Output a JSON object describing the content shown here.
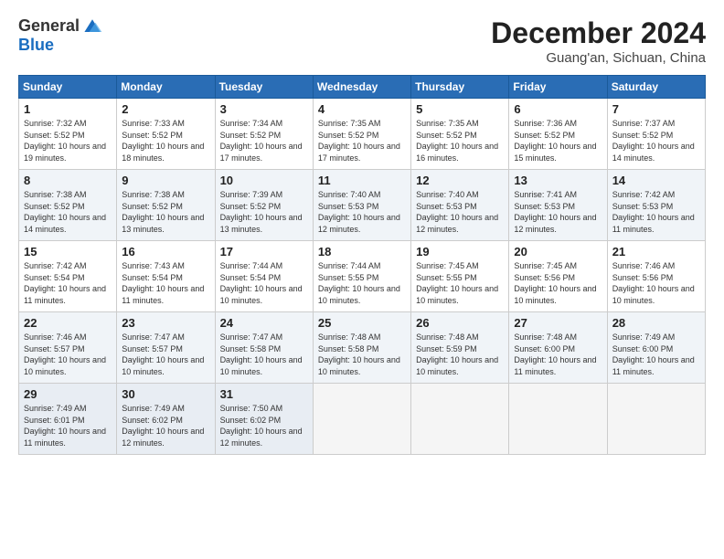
{
  "logo": {
    "general": "General",
    "blue": "Blue"
  },
  "title": "December 2024",
  "subtitle": "Guang'an, Sichuan, China",
  "days_of_week": [
    "Sunday",
    "Monday",
    "Tuesday",
    "Wednesday",
    "Thursday",
    "Friday",
    "Saturday"
  ],
  "weeks": [
    [
      {
        "day": "1",
        "sunrise": "Sunrise: 7:32 AM",
        "sunset": "Sunset: 5:52 PM",
        "daylight": "Daylight: 10 hours and 19 minutes."
      },
      {
        "day": "2",
        "sunrise": "Sunrise: 7:33 AM",
        "sunset": "Sunset: 5:52 PM",
        "daylight": "Daylight: 10 hours and 18 minutes."
      },
      {
        "day": "3",
        "sunrise": "Sunrise: 7:34 AM",
        "sunset": "Sunset: 5:52 PM",
        "daylight": "Daylight: 10 hours and 17 minutes."
      },
      {
        "day": "4",
        "sunrise": "Sunrise: 7:35 AM",
        "sunset": "Sunset: 5:52 PM",
        "daylight": "Daylight: 10 hours and 17 minutes."
      },
      {
        "day": "5",
        "sunrise": "Sunrise: 7:35 AM",
        "sunset": "Sunset: 5:52 PM",
        "daylight": "Daylight: 10 hours and 16 minutes."
      },
      {
        "day": "6",
        "sunrise": "Sunrise: 7:36 AM",
        "sunset": "Sunset: 5:52 PM",
        "daylight": "Daylight: 10 hours and 15 minutes."
      },
      {
        "day": "7",
        "sunrise": "Sunrise: 7:37 AM",
        "sunset": "Sunset: 5:52 PM",
        "daylight": "Daylight: 10 hours and 14 minutes."
      }
    ],
    [
      {
        "day": "8",
        "sunrise": "Sunrise: 7:38 AM",
        "sunset": "Sunset: 5:52 PM",
        "daylight": "Daylight: 10 hours and 14 minutes."
      },
      {
        "day": "9",
        "sunrise": "Sunrise: 7:38 AM",
        "sunset": "Sunset: 5:52 PM",
        "daylight": "Daylight: 10 hours and 13 minutes."
      },
      {
        "day": "10",
        "sunrise": "Sunrise: 7:39 AM",
        "sunset": "Sunset: 5:52 PM",
        "daylight": "Daylight: 10 hours and 13 minutes."
      },
      {
        "day": "11",
        "sunrise": "Sunrise: 7:40 AM",
        "sunset": "Sunset: 5:53 PM",
        "daylight": "Daylight: 10 hours and 12 minutes."
      },
      {
        "day": "12",
        "sunrise": "Sunrise: 7:40 AM",
        "sunset": "Sunset: 5:53 PM",
        "daylight": "Daylight: 10 hours and 12 minutes."
      },
      {
        "day": "13",
        "sunrise": "Sunrise: 7:41 AM",
        "sunset": "Sunset: 5:53 PM",
        "daylight": "Daylight: 10 hours and 12 minutes."
      },
      {
        "day": "14",
        "sunrise": "Sunrise: 7:42 AM",
        "sunset": "Sunset: 5:53 PM",
        "daylight": "Daylight: 10 hours and 11 minutes."
      }
    ],
    [
      {
        "day": "15",
        "sunrise": "Sunrise: 7:42 AM",
        "sunset": "Sunset: 5:54 PM",
        "daylight": "Daylight: 10 hours and 11 minutes."
      },
      {
        "day": "16",
        "sunrise": "Sunrise: 7:43 AM",
        "sunset": "Sunset: 5:54 PM",
        "daylight": "Daylight: 10 hours and 11 minutes."
      },
      {
        "day": "17",
        "sunrise": "Sunrise: 7:44 AM",
        "sunset": "Sunset: 5:54 PM",
        "daylight": "Daylight: 10 hours and 10 minutes."
      },
      {
        "day": "18",
        "sunrise": "Sunrise: 7:44 AM",
        "sunset": "Sunset: 5:55 PM",
        "daylight": "Daylight: 10 hours and 10 minutes."
      },
      {
        "day": "19",
        "sunrise": "Sunrise: 7:45 AM",
        "sunset": "Sunset: 5:55 PM",
        "daylight": "Daylight: 10 hours and 10 minutes."
      },
      {
        "day": "20",
        "sunrise": "Sunrise: 7:45 AM",
        "sunset": "Sunset: 5:56 PM",
        "daylight": "Daylight: 10 hours and 10 minutes."
      },
      {
        "day": "21",
        "sunrise": "Sunrise: 7:46 AM",
        "sunset": "Sunset: 5:56 PM",
        "daylight": "Daylight: 10 hours and 10 minutes."
      }
    ],
    [
      {
        "day": "22",
        "sunrise": "Sunrise: 7:46 AM",
        "sunset": "Sunset: 5:57 PM",
        "daylight": "Daylight: 10 hours and 10 minutes."
      },
      {
        "day": "23",
        "sunrise": "Sunrise: 7:47 AM",
        "sunset": "Sunset: 5:57 PM",
        "daylight": "Daylight: 10 hours and 10 minutes."
      },
      {
        "day": "24",
        "sunrise": "Sunrise: 7:47 AM",
        "sunset": "Sunset: 5:58 PM",
        "daylight": "Daylight: 10 hours and 10 minutes."
      },
      {
        "day": "25",
        "sunrise": "Sunrise: 7:48 AM",
        "sunset": "Sunset: 5:58 PM",
        "daylight": "Daylight: 10 hours and 10 minutes."
      },
      {
        "day": "26",
        "sunrise": "Sunrise: 7:48 AM",
        "sunset": "Sunset: 5:59 PM",
        "daylight": "Daylight: 10 hours and 10 minutes."
      },
      {
        "day": "27",
        "sunrise": "Sunrise: 7:48 AM",
        "sunset": "Sunset: 6:00 PM",
        "daylight": "Daylight: 10 hours and 11 minutes."
      },
      {
        "day": "28",
        "sunrise": "Sunrise: 7:49 AM",
        "sunset": "Sunset: 6:00 PM",
        "daylight": "Daylight: 10 hours and 11 minutes."
      }
    ],
    [
      {
        "day": "29",
        "sunrise": "Sunrise: 7:49 AM",
        "sunset": "Sunset: 6:01 PM",
        "daylight": "Daylight: 10 hours and 11 minutes."
      },
      {
        "day": "30",
        "sunrise": "Sunrise: 7:49 AM",
        "sunset": "Sunset: 6:02 PM",
        "daylight": "Daylight: 10 hours and 12 minutes."
      },
      {
        "day": "31",
        "sunrise": "Sunrise: 7:50 AM",
        "sunset": "Sunset: 6:02 PM",
        "daylight": "Daylight: 10 hours and 12 minutes."
      },
      null,
      null,
      null,
      null
    ]
  ]
}
